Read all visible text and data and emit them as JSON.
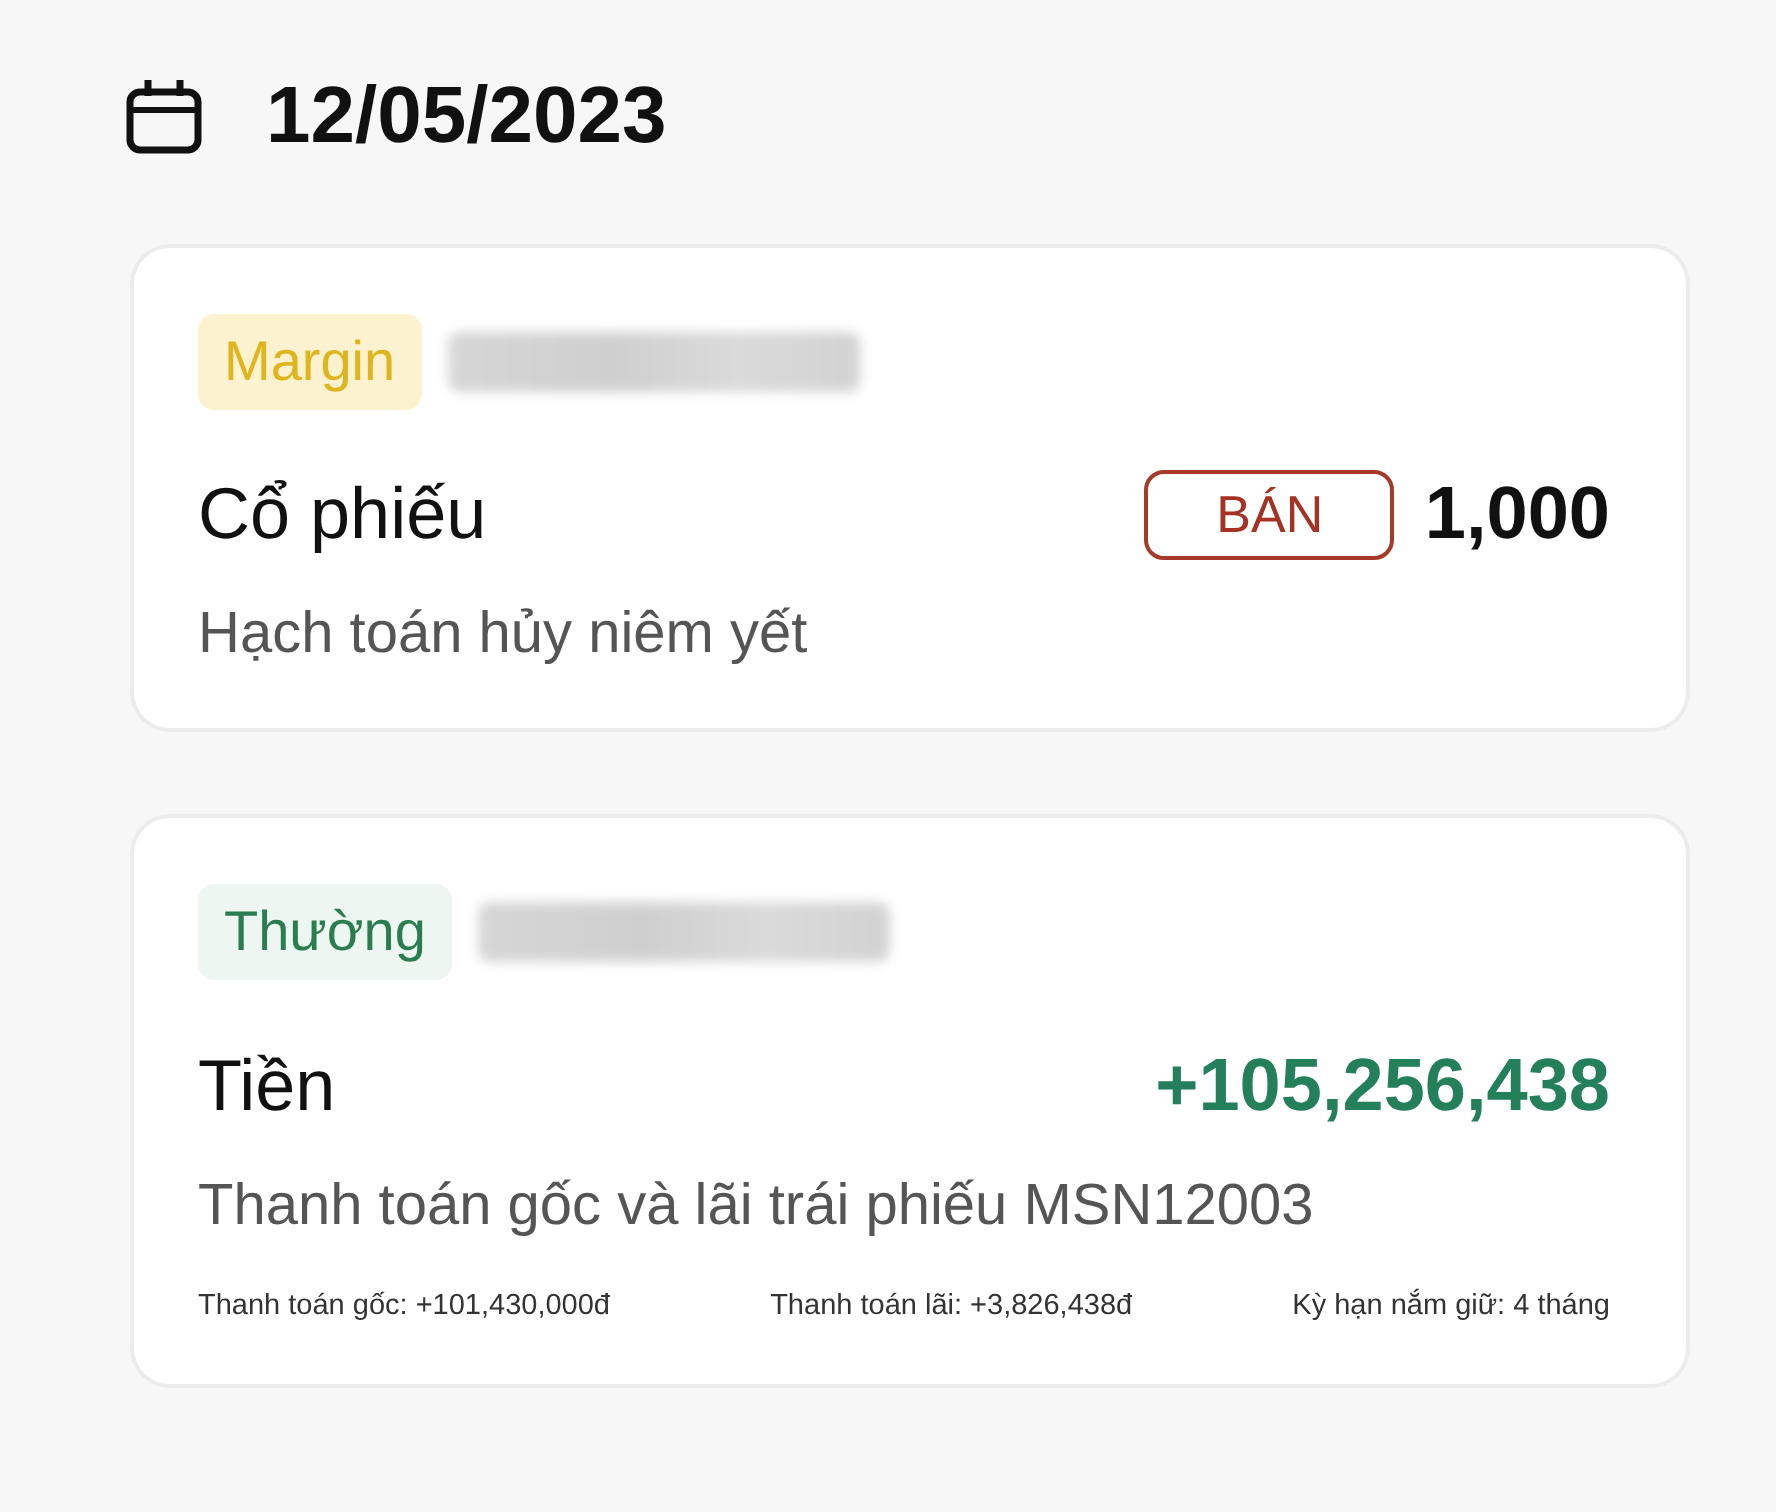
{
  "date": "12/05/2023",
  "transactions": [
    {
      "kind": "security",
      "account_type": {
        "label": "Margin",
        "kind": "margin"
      },
      "asset": "Cổ phiếu",
      "side": "BÁN",
      "value": "1,000",
      "description": "Hạch toán hủy niêm yết"
    },
    {
      "kind": "cash",
      "account_type": {
        "label": "Thường",
        "kind": "normal"
      },
      "asset": "Tiền",
      "value": "+105,256,438",
      "description": "Thanh toán gốc và lãi trái phiếu MSN12003",
      "details": [
        "Thanh toán gốc: +101,430,000đ",
        "Thanh toán lãi: +3,826,438đ",
        "Kỳ hạn nắm giữ: 4 tháng"
      ]
    }
  ]
}
